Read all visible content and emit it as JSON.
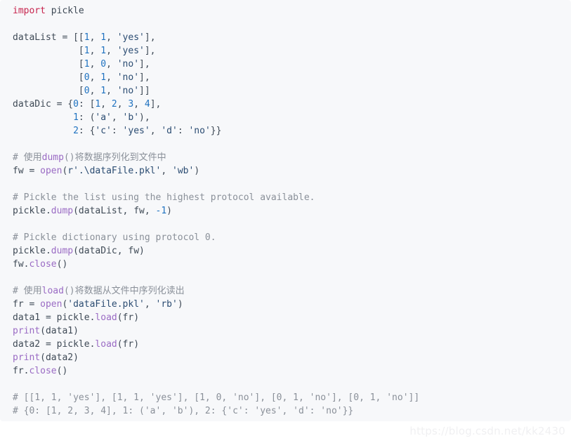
{
  "code_block": {
    "language": "python",
    "background_color": "#f7f8fa",
    "lines": [
      {
        "id": "l1",
        "text": "import pickle"
      },
      {
        "id": "l2",
        "text": ""
      },
      {
        "id": "l3",
        "text": "dataList = [[1, 1, 'yes'],"
      },
      {
        "id": "l4",
        "text": "            [1, 1, 'yes'],"
      },
      {
        "id": "l5",
        "text": "            [1, 0, 'no'],"
      },
      {
        "id": "l6",
        "text": "            [0, 1, 'no'],"
      },
      {
        "id": "l7",
        "text": "            [0, 1, 'no']]"
      },
      {
        "id": "l8",
        "text": "dataDic = {0: [1, 2, 3, 4],"
      },
      {
        "id": "l9",
        "text": "           1: ('a', 'b'),"
      },
      {
        "id": "l10",
        "text": "           2: {'c': 'yes', 'd': 'no'}}"
      },
      {
        "id": "l11",
        "text": ""
      },
      {
        "id": "l12",
        "text": "# 使用dump()将数据序列化到文件中"
      },
      {
        "id": "l13",
        "text": "fw = open(r'.\\dataFile.pkl', 'wb')"
      },
      {
        "id": "l14",
        "text": ""
      },
      {
        "id": "l15",
        "text": "# Pickle the list using the highest protocol available."
      },
      {
        "id": "l16",
        "text": "pickle.dump(dataList, fw, -1)"
      },
      {
        "id": "l17",
        "text": ""
      },
      {
        "id": "l18",
        "text": "# Pickle dictionary using protocol 0."
      },
      {
        "id": "l19",
        "text": "pickle.dump(dataDic, fw)"
      },
      {
        "id": "l20",
        "text": "fw.close()"
      },
      {
        "id": "l21",
        "text": ""
      },
      {
        "id": "l22",
        "text": "# 使用load()将数据从文件中序列化读出"
      },
      {
        "id": "l23",
        "text": "fr = open('dataFile.pkl', 'rb')"
      },
      {
        "id": "l24",
        "text": "data1 = pickle.load(fr)"
      },
      {
        "id": "l25",
        "text": "print(data1)"
      },
      {
        "id": "l26",
        "text": "data2 = pickle.load(fr)"
      },
      {
        "id": "l27",
        "text": "print(data2)"
      },
      {
        "id": "l28",
        "text": "fr.close()"
      },
      {
        "id": "l29",
        "text": ""
      },
      {
        "id": "l30",
        "text": "# [[1, 1, 'yes'], [1, 1, 'yes'], [1, 0, 'no'], [0, 1, 'no'], [0, 1, 'no']]"
      },
      {
        "id": "l31",
        "text": "# {0: [1, 2, 3, 4], 1: ('a', 'b'), 2: {'c': 'yes', 'd': 'no'}}"
      }
    ],
    "tokens": {
      "keywords": [
        "import"
      ],
      "builtins": [
        "open",
        "print"
      ],
      "methods": [
        "dump",
        "load",
        "close"
      ],
      "identifiers": [
        "pickle",
        "dataList",
        "dataDic",
        "fw",
        "fr",
        "data1",
        "data2"
      ],
      "strings": [
        "'yes'",
        "'no'",
        "'a'",
        "'b'",
        "'c'",
        "'d'",
        "'wb'",
        "'rb'",
        "r'.\\dataFile.pkl'",
        "'dataFile.pkl'"
      ],
      "numbers": [
        "0",
        "1",
        "2",
        "3",
        "4",
        "-1"
      ]
    },
    "colors": {
      "keyword": "#c7254e",
      "builtin": "#9a6bc4",
      "number": "#1f72c0",
      "string": "#2b4c72",
      "comment": "#8a9099",
      "identifier": "#3f4a56",
      "background": "#f7f8fa"
    }
  },
  "watermark": {
    "text": "https://blog.csdn.net/kk2430",
    "color": "#f0f0f2"
  }
}
